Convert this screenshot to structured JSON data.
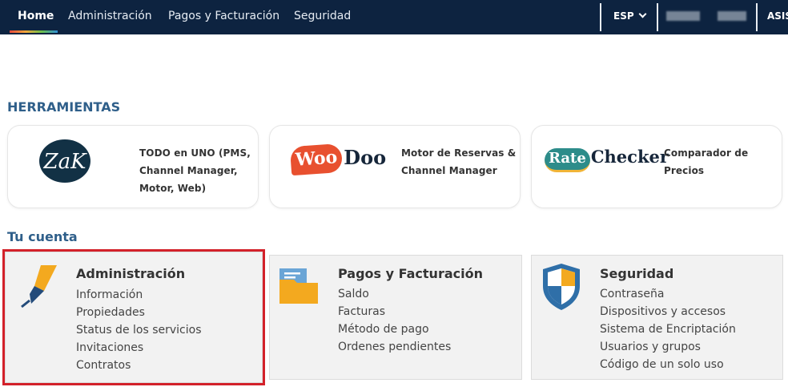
{
  "nav": {
    "home": "Home",
    "administracion": "Administración",
    "pagos": "Pagos y Facturación",
    "seguridad": "Seguridad",
    "language": "ESP",
    "user_cut": "ASIS"
  },
  "sections": {
    "herramientas": "HERRAMIENTAS",
    "tu_cuenta": "Tu cuenta"
  },
  "tools": [
    {
      "logo": "ZaK",
      "desc_lines": [
        "TODO en UNO (PMS,",
        "Channel Manager,",
        "Motor, Web)"
      ]
    },
    {
      "logo_a": "Woo",
      "logo_b": "Doo",
      "desc_lines": [
        "Motor de Reservas &",
        "Channel Manager"
      ]
    },
    {
      "logo_a": "Rate",
      "logo_b": "Checker",
      "desc_lines": [
        "Comparador de",
        "Precios"
      ]
    }
  ],
  "account": [
    {
      "title": "Administración",
      "icon": "fountain-pen-icon",
      "links": [
        "Información",
        "Propiedades",
        "Status de los servicios",
        "Invitaciones",
        "Contratos"
      ]
    },
    {
      "title": "Pagos y Facturación",
      "icon": "folder-icon",
      "links": [
        "Saldo",
        "Facturas",
        "Método de pago",
        "Ordenes pendientes"
      ]
    },
    {
      "title": "Seguridad",
      "icon": "shield-icon",
      "links": [
        "Contraseña",
        "Dispositivos y accesos",
        "Sistema de Encriptación",
        "Usuarios y grupos",
        "Código de un solo uso"
      ]
    }
  ],
  "colors": {
    "topbar": "#0d2340",
    "section_title": "#2f5f8a",
    "selected_outline": "#d3212a"
  }
}
